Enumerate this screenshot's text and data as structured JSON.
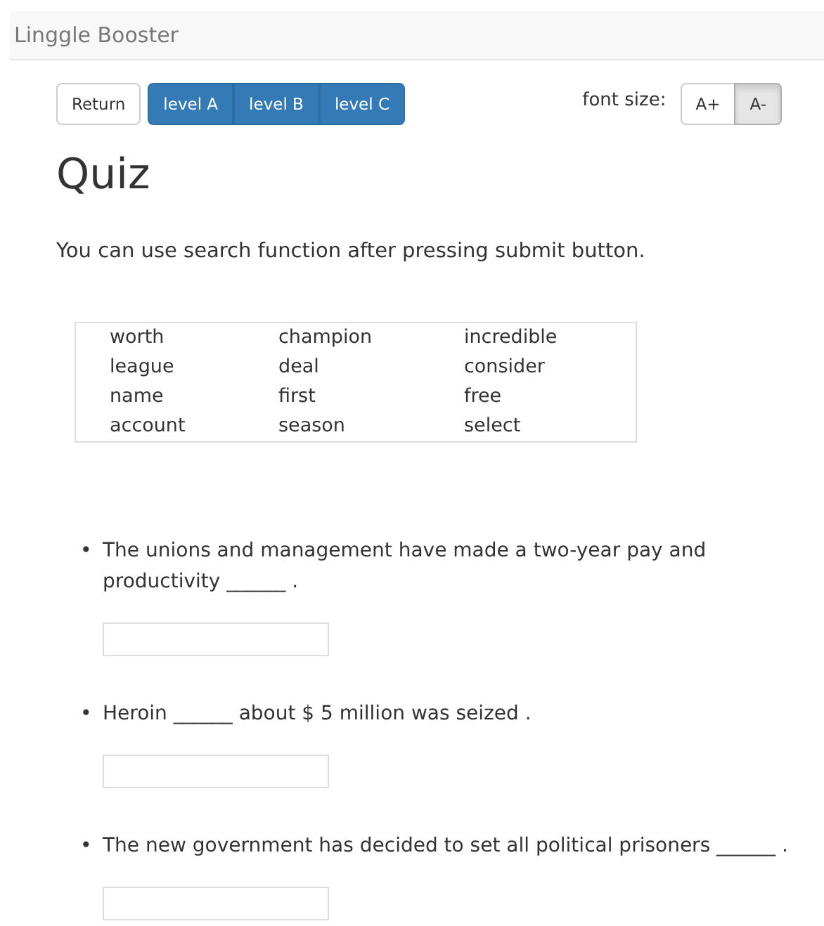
{
  "navbar": {
    "brand": "Linggle Booster"
  },
  "toolbar": {
    "return": "Return",
    "levels": [
      "level A",
      "level B",
      "level C"
    ],
    "font_size_label": "font size:",
    "font_buttons": [
      {
        "label": "A+",
        "selected": false
      },
      {
        "label": "A-",
        "selected": true
      }
    ]
  },
  "title": "Quiz",
  "instruction": "You can use search function after pressing submit button.",
  "word_bank": [
    [
      "worth",
      "champion",
      "incredible"
    ],
    [
      "league",
      "deal",
      "consider"
    ],
    [
      "name",
      "first",
      "free"
    ],
    [
      "account",
      "season",
      "select"
    ]
  ],
  "questions": [
    {
      "bullet": "•",
      "text": "The unions and management have made a two-year pay and productivity ______ ."
    },
    {
      "bullet": "•",
      "text": "Heroin ______ about $ 5 million was seized ."
    },
    {
      "bullet": "•",
      "text": "The new government has decided to set all political prisoners ______ ."
    }
  ]
}
